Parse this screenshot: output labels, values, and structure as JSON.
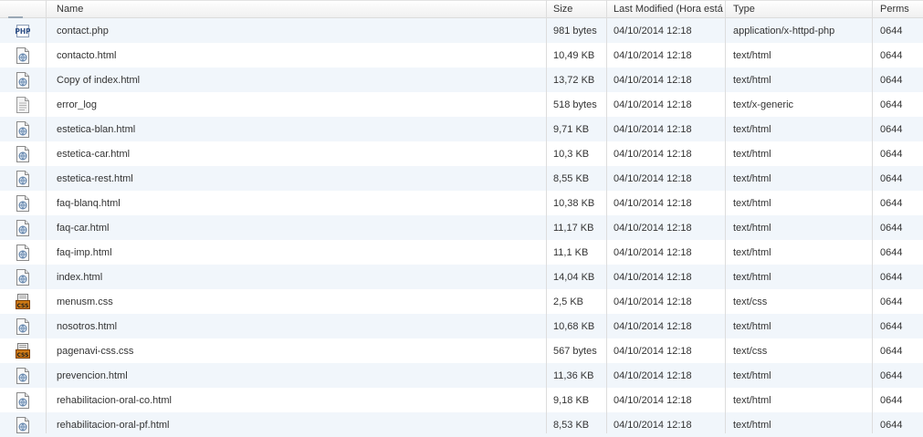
{
  "columns": {
    "name": "Name",
    "size": "Size",
    "modified": "Last Modified (Hora está",
    "type": "Type",
    "perms": "Perms"
  },
  "files": [
    {
      "icon": "php-file-icon",
      "name": "contact.php",
      "size": "981 bytes",
      "modified": "04/10/2014 12:18",
      "type": "application/x-httpd-php",
      "perms": "0644"
    },
    {
      "icon": "html-file-icon",
      "name": "contacto.html",
      "size": "10,49 KB",
      "modified": "04/10/2014 12:18",
      "type": "text/html",
      "perms": "0644"
    },
    {
      "icon": "html-file-icon",
      "name": "Copy of index.html",
      "size": "13,72 KB",
      "modified": "04/10/2014 12:18",
      "type": "text/html",
      "perms": "0644"
    },
    {
      "icon": "text-file-icon",
      "name": "error_log",
      "size": "518 bytes",
      "modified": "04/10/2014 12:18",
      "type": "text/x-generic",
      "perms": "0644"
    },
    {
      "icon": "html-file-icon",
      "name": "estetica-blan.html",
      "size": "9,71 KB",
      "modified": "04/10/2014 12:18",
      "type": "text/html",
      "perms": "0644"
    },
    {
      "icon": "html-file-icon",
      "name": "estetica-car.html",
      "size": "10,3 KB",
      "modified": "04/10/2014 12:18",
      "type": "text/html",
      "perms": "0644"
    },
    {
      "icon": "html-file-icon",
      "name": "estetica-rest.html",
      "size": "8,55 KB",
      "modified": "04/10/2014 12:18",
      "type": "text/html",
      "perms": "0644"
    },
    {
      "icon": "html-file-icon",
      "name": "faq-blanq.html",
      "size": "10,38 KB",
      "modified": "04/10/2014 12:18",
      "type": "text/html",
      "perms": "0644"
    },
    {
      "icon": "html-file-icon",
      "name": "faq-car.html",
      "size": "11,17 KB",
      "modified": "04/10/2014 12:18",
      "type": "text/html",
      "perms": "0644"
    },
    {
      "icon": "html-file-icon",
      "name": "faq-imp.html",
      "size": "11,1 KB",
      "modified": "04/10/2014 12:18",
      "type": "text/html",
      "perms": "0644"
    },
    {
      "icon": "html-file-icon",
      "name": "index.html",
      "size": "14,04 KB",
      "modified": "04/10/2014 12:18",
      "type": "text/html",
      "perms": "0644"
    },
    {
      "icon": "css-file-icon",
      "name": "menusm.css",
      "size": "2,5 KB",
      "modified": "04/10/2014 12:18",
      "type": "text/css",
      "perms": "0644"
    },
    {
      "icon": "html-file-icon",
      "name": "nosotros.html",
      "size": "10,68 KB",
      "modified": "04/10/2014 12:18",
      "type": "text/html",
      "perms": "0644"
    },
    {
      "icon": "css-file-icon",
      "name": "pagenavi-css.css",
      "size": "567 bytes",
      "modified": "04/10/2014 12:18",
      "type": "text/css",
      "perms": "0644"
    },
    {
      "icon": "html-file-icon",
      "name": "prevencion.html",
      "size": "11,36 KB",
      "modified": "04/10/2014 12:18",
      "type": "text/html",
      "perms": "0644"
    },
    {
      "icon": "html-file-icon",
      "name": "rehabilitacion-oral-co.html",
      "size": "9,18 KB",
      "modified": "04/10/2014 12:18",
      "type": "text/html",
      "perms": "0644"
    },
    {
      "icon": "html-file-icon",
      "name": "rehabilitacion-oral-pf.html",
      "size": "8,53 KB",
      "modified": "04/10/2014 12:18",
      "type": "text/html",
      "perms": "0644"
    }
  ]
}
